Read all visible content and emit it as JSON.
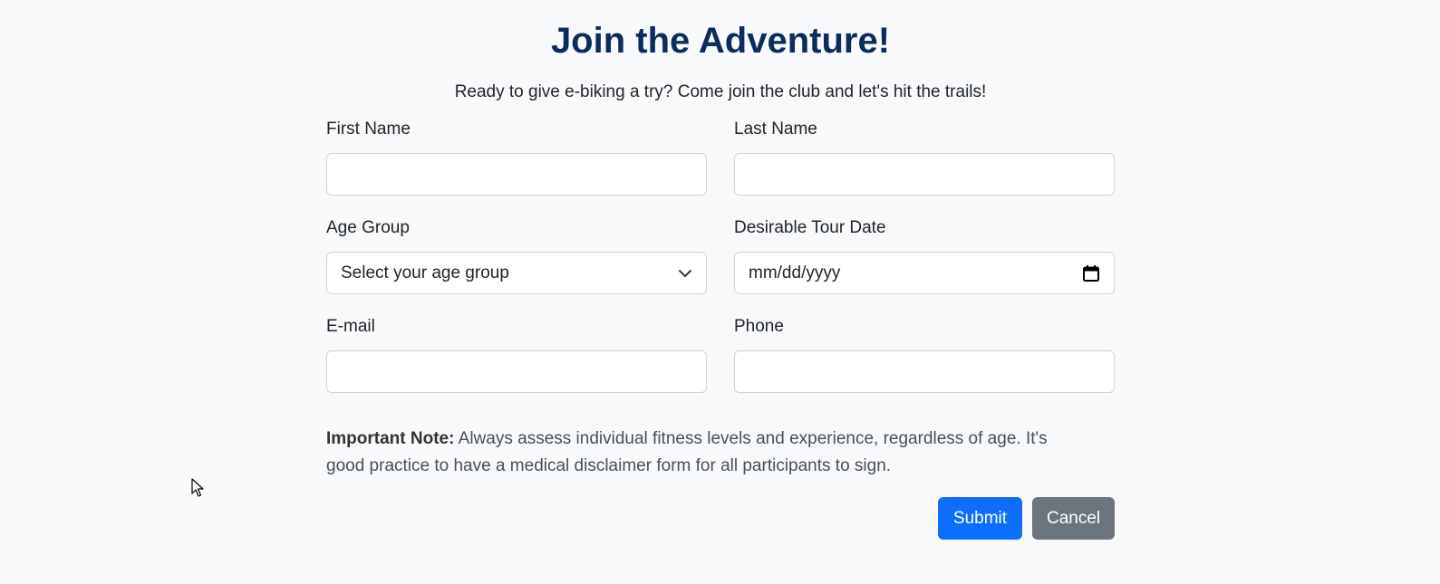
{
  "header": {
    "title": "Join the Adventure!",
    "subtitle": "Ready to give e-biking a try? Come join the club and let's hit the trails!"
  },
  "form": {
    "first_name": {
      "label": "First Name",
      "value": ""
    },
    "last_name": {
      "label": "Last Name",
      "value": ""
    },
    "age_group": {
      "label": "Age Group",
      "selected": "Select your age group"
    },
    "tour_date": {
      "label": "Desirable Tour Date",
      "placeholder": "mm/dd/yyyy"
    },
    "email": {
      "label": "E-mail",
      "value": ""
    },
    "phone": {
      "label": "Phone",
      "value": ""
    }
  },
  "note": {
    "label": "Important Note:",
    "text": " Always assess individual fitness levels and experience, regardless of age. It's good practice to have a medical disclaimer form for all participants to sign."
  },
  "actions": {
    "submit_label": "Submit",
    "cancel_label": "Cancel"
  },
  "colors": {
    "title": "#0d2c5e",
    "primary": "#0d6efd",
    "secondary": "#6c757d",
    "background": "#f8f9fa"
  },
  "icons": [
    "chevron-down-icon",
    "calendar-icon",
    "mouse-cursor-icon"
  ]
}
